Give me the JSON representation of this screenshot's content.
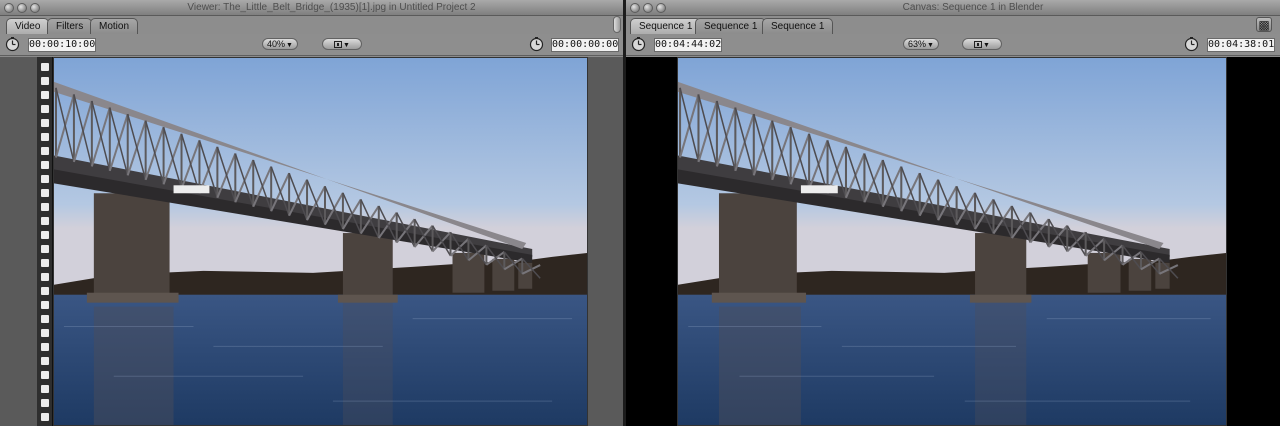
{
  "viewer": {
    "title": "Viewer: The_Little_Belt_Bridge_(1935)[1].jpg in Untitled Project 2",
    "tabs": [
      "Video",
      "Filters",
      "Motion"
    ],
    "duration_timecode": "00:00:10:00",
    "zoom": "40%",
    "current_timecode": "00:00:00:00",
    "image_alt": "Steel truss bridge over water at dusk"
  },
  "canvas": {
    "title": "Canvas: Sequence 1 in Blender",
    "tabs": [
      "Sequence 1",
      "Sequence 1",
      "Sequence 1"
    ],
    "duration_timecode": "00:04:44:02",
    "zoom": "63%",
    "current_timecode": "00:04:38:01",
    "image_alt": "Steel truss bridge over water at dusk"
  },
  "colors": {
    "panel_gray": "#8b8b8b",
    "sky_top": "#7fa4d6",
    "water": "#1e3a63",
    "letterbox": "#000000"
  },
  "icons": [
    "close-icon",
    "minimize-icon",
    "zoom-icon",
    "timecode-clock-icon",
    "view-layout-icon",
    "camera-icon"
  ]
}
